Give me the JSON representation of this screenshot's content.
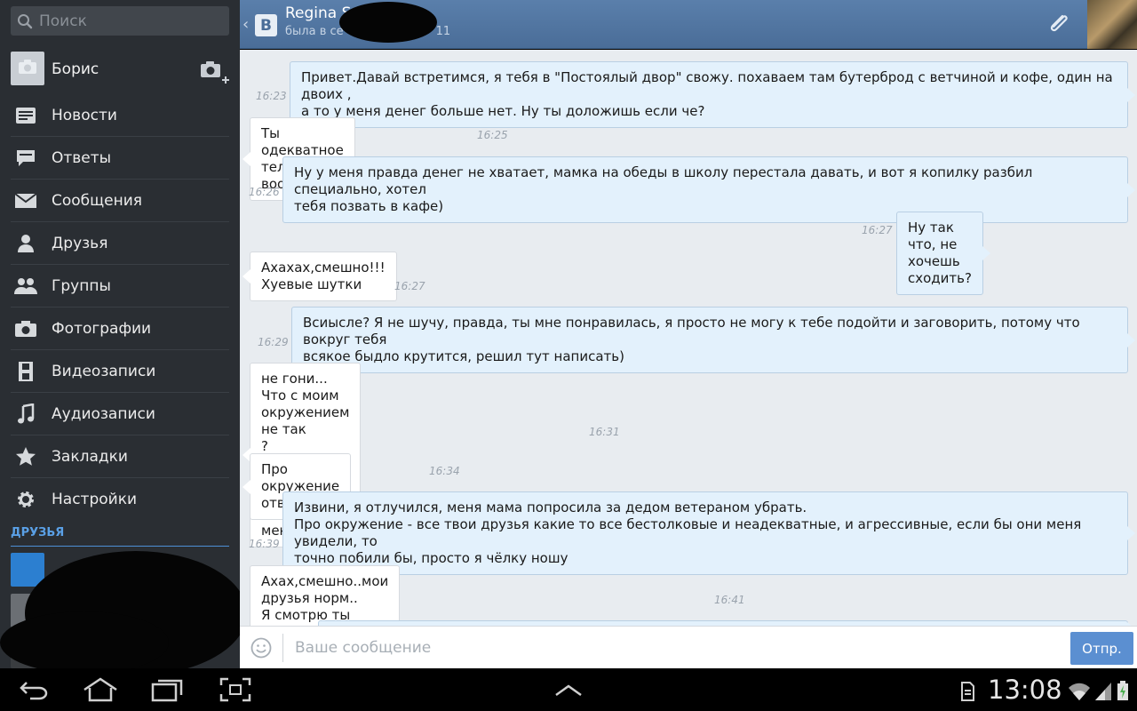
{
  "sidebar": {
    "search_placeholder": "Поиск",
    "profile_name": "Борис",
    "menu": [
      {
        "label": "Новости",
        "icon": "news-icon"
      },
      {
        "label": "Ответы",
        "icon": "replies-icon"
      },
      {
        "label": "Сообщения",
        "icon": "messages-icon"
      },
      {
        "label": "Друзья",
        "icon": "friends-icon"
      },
      {
        "label": "Группы",
        "icon": "groups-icon"
      },
      {
        "label": "Фотографии",
        "icon": "photos-icon"
      },
      {
        "label": "Видеозаписи",
        "icon": "video-icon"
      },
      {
        "label": "Аудиозаписи",
        "icon": "audio-icon"
      },
      {
        "label": "Закладки",
        "icon": "star-icon"
      },
      {
        "label": "Настройки",
        "icon": "gear-icon"
      }
    ],
    "friends_header": "ДРУЗЬЯ"
  },
  "header": {
    "name": "Regina S",
    "status": "была в се",
    "status_tail": "11"
  },
  "messages": [
    {
      "dir": "out",
      "text": "Привет.Давай встретимся, я тебя в \"Постоялый двор\" свожу. похаваем там бутерброд с ветчиной и кофе, один на двоих ,\nа то у меня денег больше нет. Ну ты доложишь если че?",
      "time": "16:23"
    },
    {
      "dir": "in",
      "text": "Ты одекватное тело вообще?",
      "time": "16:25"
    },
    {
      "dir": "out",
      "text": "Ну у меня правда денег не хватает, мамка на обеды в школу перестала давать, и вот я копилку разбил специально, хотел\nтебя позвать в кафе)",
      "time": "16:26"
    },
    {
      "dir": "out",
      "text": "Ну так что, не хочешь сходить?",
      "time": "16:27"
    },
    {
      "dir": "in",
      "text": "Ахахах,смешно!!!\nХуевые шутки",
      "time": "16:27"
    },
    {
      "dir": "out",
      "text": "Всиысле? Я не шучу, правда, ты мне понравилась, я просто не могу к тебе подойти и заговорить, потому что вокруг тебя\nвсякое быдло крутится, решил тут написать)",
      "time": "16:29"
    },
    {
      "dir": "in",
      "text": "не гони...\nЧто с моим окружением не так\n?\nВот реально ахуенный развод,но не для меня!",
      "time": "16:31"
    },
    {
      "dir": "in",
      "text": "Про окружение ответь",
      "time": "16:34"
    },
    {
      "dir": "out",
      "text": "Извини, я отлучился, меня мама попросила за дедом ветераном убрать.\nПро окружение - все твои друзья какие то все бестолковые и неадекватные, и агрессивные, если бы они меня увидели, то\nточно побили бы, просто я чёлку ношу",
      "time": "16:39"
    },
    {
      "dir": "in",
      "text": "Ахах,смешно..мои друзья норм..\nЯ смотрю ты истории махом сочиняешь,прям на лету и от души!!",
      "time": "16:41"
    }
  ],
  "compose": {
    "placeholder": "Ваше сообщение",
    "send_label": "Отпр."
  },
  "system": {
    "clock": "13:08"
  },
  "colors": {
    "accent": "#4a6d98",
    "send": "#5b8fd1",
    "out_bubble": "#e3f1fc",
    "sidebar": "#2a2e33"
  }
}
